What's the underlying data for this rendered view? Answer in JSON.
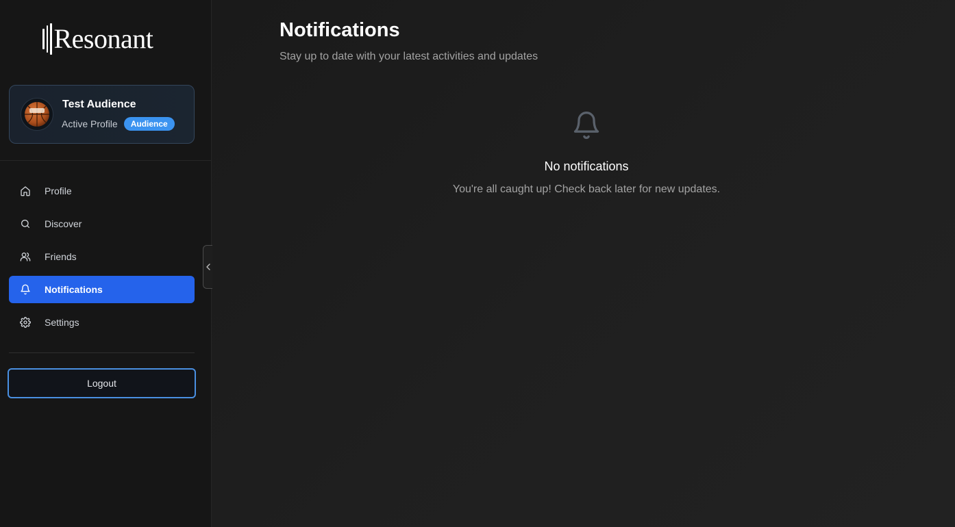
{
  "brand": {
    "name": "Resonant"
  },
  "profile": {
    "name": "Test Audience",
    "status_label": "Active Profile",
    "role_badge": "Audience",
    "avatar_icon": "basketball-icon"
  },
  "nav": {
    "items": [
      {
        "label": "Profile",
        "icon": "home-icon",
        "active": false
      },
      {
        "label": "Discover",
        "icon": "search-icon",
        "active": false
      },
      {
        "label": "Friends",
        "icon": "users-icon",
        "active": false
      },
      {
        "label": "Notifications",
        "icon": "bell-icon",
        "active": true
      },
      {
        "label": "Settings",
        "icon": "gear-icon",
        "active": false
      }
    ]
  },
  "logout_label": "Logout",
  "header": {
    "title": "Notifications",
    "subtitle": "Stay up to date with your latest activities and updates"
  },
  "empty_state": {
    "icon": "bell-icon",
    "title": "No notifications",
    "description": "You're all caught up! Check back later for new updates."
  },
  "colors": {
    "accent": "#2563eb",
    "badge": "#3b93f0",
    "logout_border": "#4a90e2"
  }
}
